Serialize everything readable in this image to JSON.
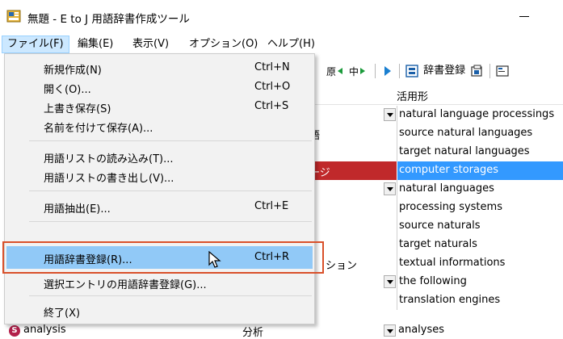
{
  "window": {
    "title": "無題 - E to J 用語辞書作成ツール"
  },
  "menubar": {
    "items": [
      "ファイル(F)",
      "編集(E)",
      "表示(V)",
      "オプション(O)",
      "ヘルプ(H)"
    ]
  },
  "toolbar": {
    "dict_register_label": "辞書登録"
  },
  "file_menu": {
    "items": [
      {
        "label": "新規作成(N)",
        "shortcut": "Ctrl+N"
      },
      {
        "label": "開く(O)...",
        "shortcut": "Ctrl+O"
      },
      {
        "label": "上書き保存(S)",
        "shortcut": "Ctrl+S"
      },
      {
        "label": "名前を付けて保存(A)...",
        "shortcut": ""
      },
      {
        "label": "用語リストの読み込み(T)...",
        "shortcut": ""
      },
      {
        "label": "用語リストの書き出し(V)...",
        "shortcut": ""
      },
      {
        "label": "用語抽出(E)...",
        "shortcut": "Ctrl+E"
      },
      {
        "label": "用語辞書登録(R)...",
        "shortcut": "Ctrl+R"
      },
      {
        "label": "選択エントリの用語辞書登録(G)...",
        "shortcut": ""
      },
      {
        "label": "終了(X)",
        "shortcut": ""
      }
    ]
  },
  "grid": {
    "column_header": "活用形",
    "rows": [
      {
        "jp": "",
        "en": "natural language processings"
      },
      {
        "jp": "語",
        "en": "source natural languages"
      },
      {
        "jp": "",
        "en": "target natural languages"
      },
      {
        "jp": "ージ",
        "en": "computer storages"
      },
      {
        "jp": "",
        "en": "natural languages"
      },
      {
        "jp": "",
        "en": "processing systems"
      },
      {
        "jp": "",
        "en": "source naturals"
      },
      {
        "jp": "",
        "en": "target naturals"
      },
      {
        "jp": "ション",
        "en": "textual informations"
      },
      {
        "jp": "",
        "en": "the following"
      },
      {
        "jp": "",
        "en": "translation engines"
      }
    ],
    "bottom": {
      "badge": "S",
      "text": "analysis",
      "jp": "分析",
      "en": "analyses"
    }
  },
  "colors": {
    "menu_hover": "#91c9f7",
    "selected_row": "#3399ff",
    "selected_jp_cell": "#c0292b",
    "callout_border": "#d9502a"
  }
}
